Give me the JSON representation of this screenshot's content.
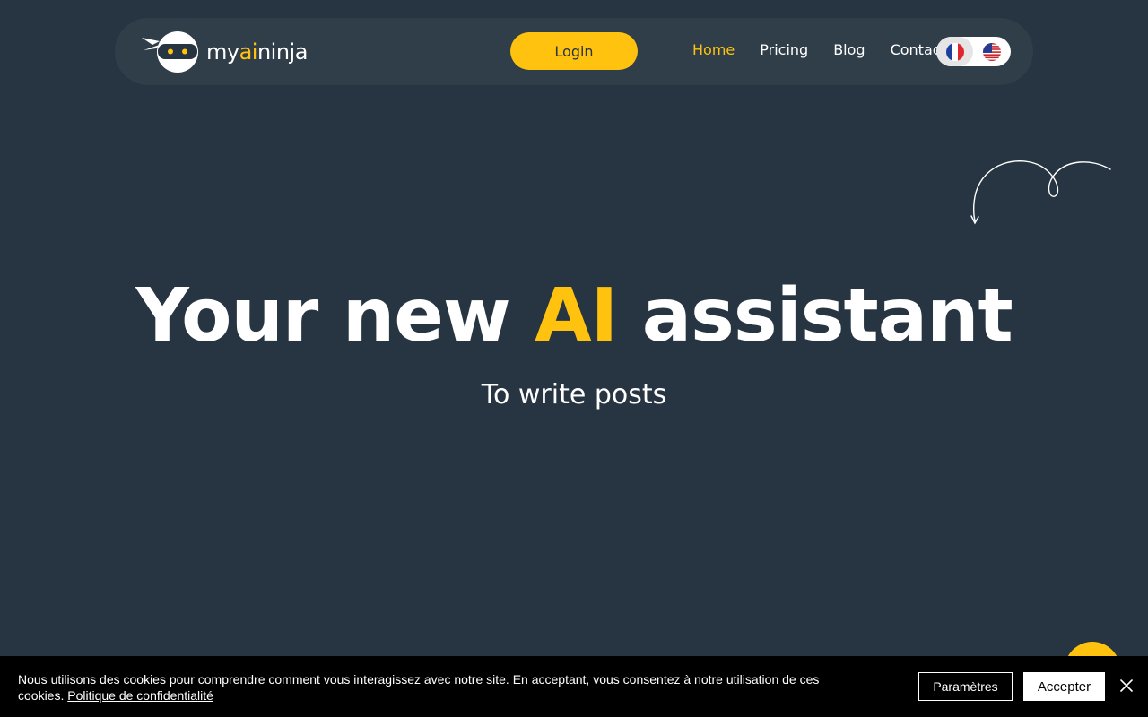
{
  "brand": {
    "name_pre": "my",
    "name_ai": "ai",
    "name_post": "ninja",
    "accent_color": "#ffc20e",
    "logo_icon": "ninja-head-icon"
  },
  "nav": {
    "login_label": "Login",
    "links": [
      {
        "label": "Home",
        "active": true
      },
      {
        "label": "Pricing",
        "active": false
      },
      {
        "label": "Blog",
        "active": false
      },
      {
        "label": "Contact",
        "active": false
      }
    ],
    "languages": [
      {
        "icon": "france-flag-icon",
        "selected": true
      },
      {
        "icon": "usa-flag-icon",
        "selected": false
      }
    ]
  },
  "hero": {
    "title_pre": "Your new ",
    "title_highlight": "AI",
    "title_post": " assistant",
    "subtitle": "To write posts",
    "decoration_icon": "curly-arrow-icon"
  },
  "cookie_banner": {
    "text": "Nous utilisons des cookies pour comprendre comment vous interagissez avec notre site. En acceptant, vous consentez à notre utilisation de ces cookies.",
    "privacy_link": "Politique de confidentialité",
    "settings_label": "Paramètres",
    "accept_label": "Accepter",
    "close_icon": "close-icon"
  },
  "colors": {
    "background": "#263541",
    "navbar": "#303e4a",
    "accent": "#ffc20e"
  }
}
